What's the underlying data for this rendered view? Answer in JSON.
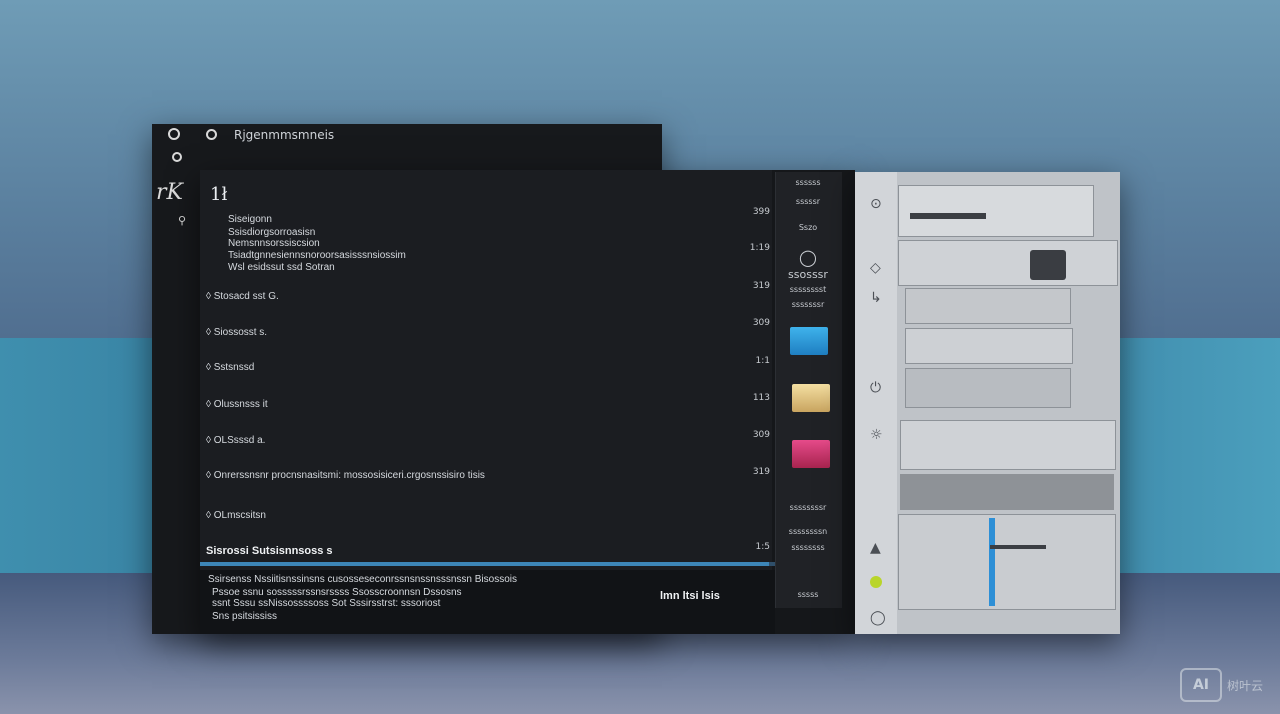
{
  "window": {
    "title": "Rjgenmmsmneis",
    "heading": "1ł",
    "left_rail_glyph": "rK"
  },
  "content": {
    "intro_lines": [
      "Siseigonn",
      "Ssisdiorgsorroasisn",
      "Nemsnnsorssiscsion",
      "Tsiadtgnnesiennsnoroorsasisssnsiossim",
      "Wsl esidssut ssd Sotran"
    ],
    "items": [
      {
        "label": "Stosacd sst G.",
        "number": ""
      },
      {
        "label": "Siossosst s.",
        "number": "309"
      },
      {
        "label": "Sstsnssd",
        "number": ""
      },
      {
        "label": "Olussnsss it",
        "number": "113"
      },
      {
        "label": "OLSsssd a.",
        "number": "309"
      },
      {
        "label": "Onrerssnsnr procnsnasitsmi: mossosisiceri.crgosnssisiro tisis",
        "number": ""
      },
      {
        "label": "OLmscsitsn",
        "number": "319"
      }
    ],
    "bold_line": "Sisrossi Sutsisnnsoss s",
    "right_numbers": [
      "399",
      "1:19",
      "319",
      "309",
      "1:1",
      "113",
      "309",
      "319",
      "1:5"
    ]
  },
  "footer": {
    "lines": [
      "Ssirsenss Nssiitisnssinsns cusosseseconrssnsnssnsssnssn Bisossois",
      "Pssoe ssnu sosssssrssnsrssss Ssosscroonnsn Dssosns",
      "ssnt Sssu ssNissossssoss Sot Sssirsstrst: sssoriost",
      "Sns psitsississ"
    ],
    "status": "lmn ltsi lsis"
  },
  "side": {
    "items": [
      "ssssss",
      "sssssr",
      "Sszo",
      "ssosssr",
      "sssssssst",
      "sssssssr",
      "ssssssssr",
      "ssssssssn",
      "ssssssss",
      "sssss"
    ]
  },
  "colors": {
    "accent_blue": "#2d8fd6",
    "tile_blue": "#3fb3ec",
    "tile_yellow": "#f4dfa2",
    "tile_pink": "#e64b8a",
    "status_green": "#b9d52a"
  },
  "progress_fraction": 0.99,
  "watermark": {
    "badge": "AI",
    "text": "树叶云"
  }
}
